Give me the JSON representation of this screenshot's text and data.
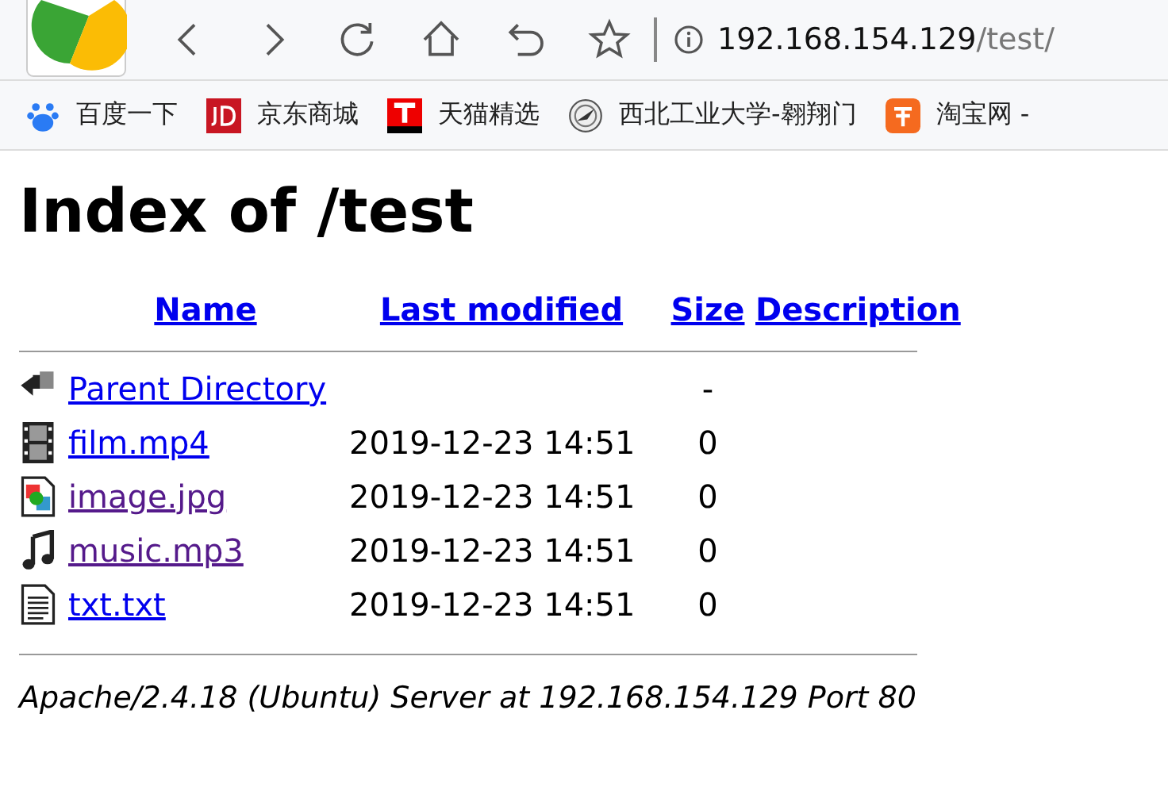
{
  "toolbar": {
    "address_host": "192.168.154.129",
    "address_path": "/test/"
  },
  "bookmarks": [
    {
      "label": "百度一下",
      "kind": "paw"
    },
    {
      "label": "京东商城",
      "kind": "jd"
    },
    {
      "label": "天猫精选",
      "kind": "tmall"
    },
    {
      "label": "西北工业大学-翱翔门",
      "kind": "seal"
    },
    {
      "label": "淘宝网 -",
      "kind": "taobao"
    }
  ],
  "page": {
    "title": "Index of /test",
    "columns": [
      "Name",
      "Last modified",
      "Size",
      "Description"
    ],
    "rows": [
      {
        "kind": "back",
        "name": "Parent Directory",
        "modified": "",
        "size": "-",
        "visited": false
      },
      {
        "kind": "video",
        "name": "film.mp4",
        "modified": "2019-12-23 14:51",
        "size": "0",
        "visited": false
      },
      {
        "kind": "image",
        "name": "image.jpg",
        "modified": "2019-12-23 14:51",
        "size": "0",
        "visited": true
      },
      {
        "kind": "audio",
        "name": "music.mp3",
        "modified": "2019-12-23 14:51",
        "size": "0",
        "visited": true
      },
      {
        "kind": "text",
        "name": "txt.txt",
        "modified": "2019-12-23 14:51",
        "size": "0",
        "visited": false
      }
    ],
    "footer": "Apache/2.4.18 (Ubuntu) Server at 192.168.154.129 Port 80"
  }
}
